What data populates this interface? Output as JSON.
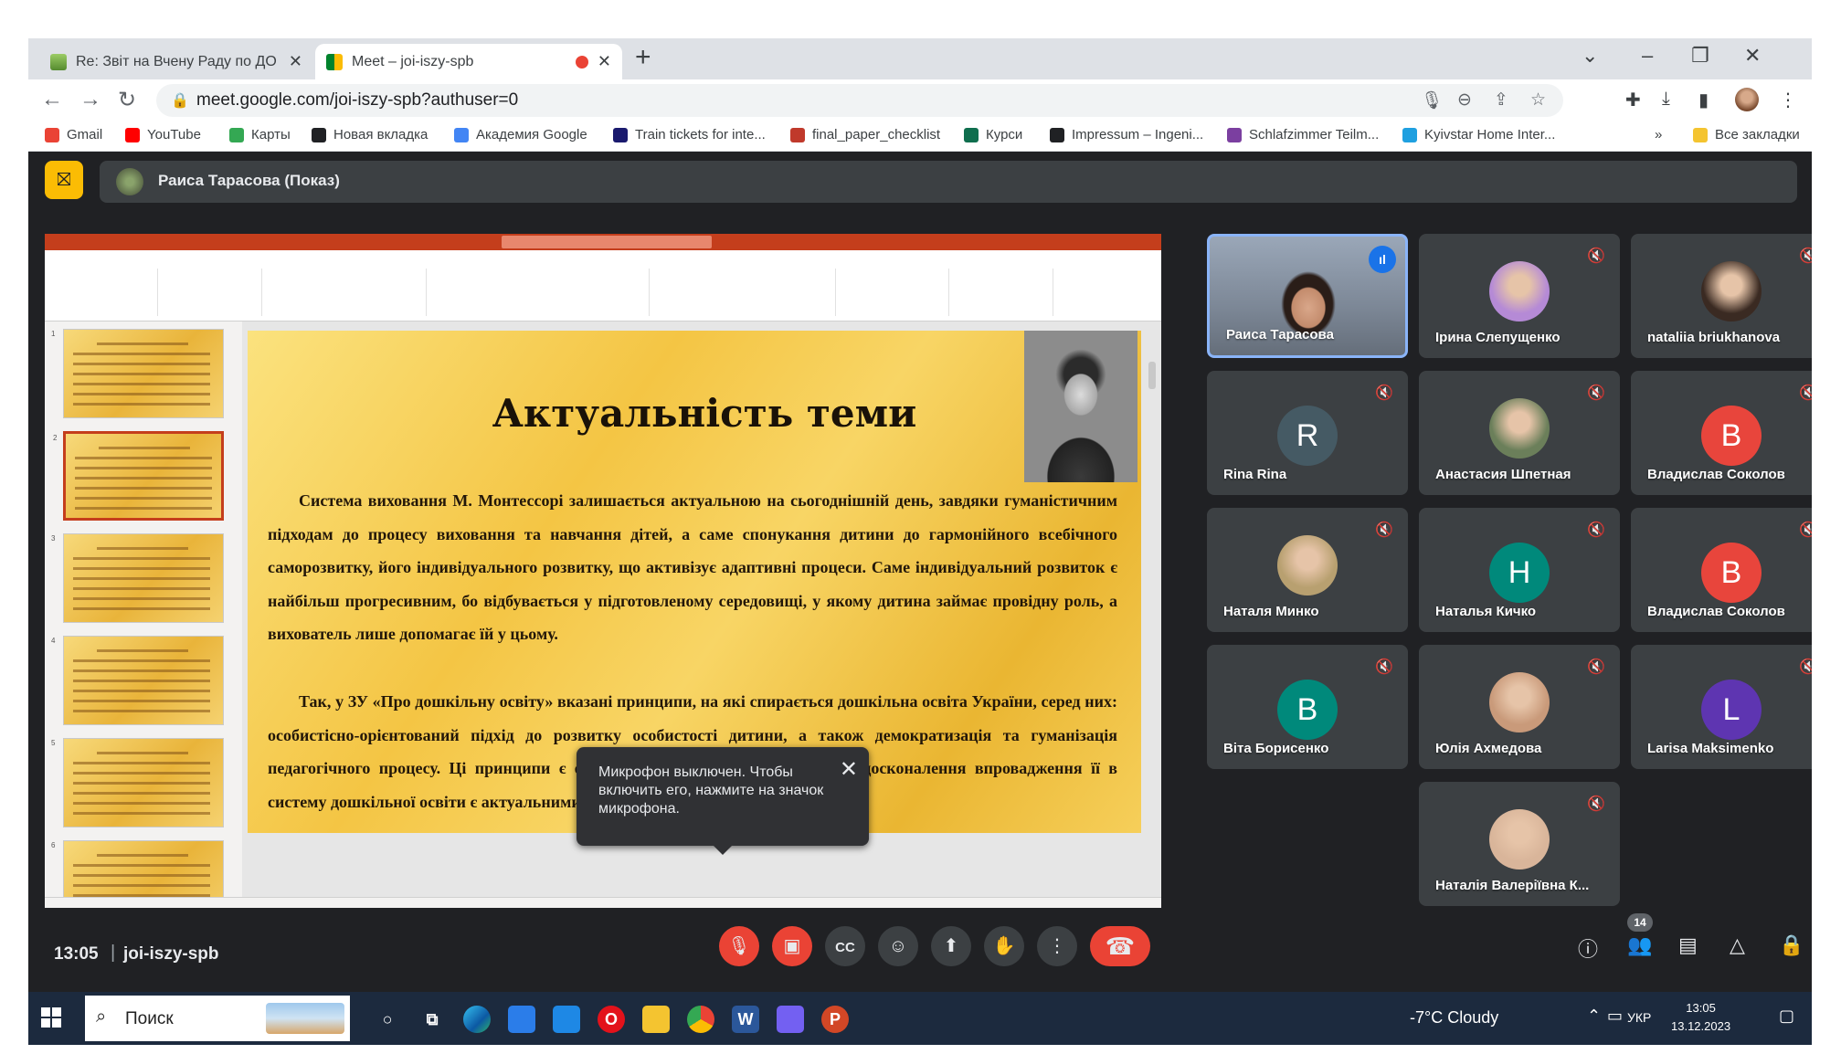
{
  "browser": {
    "tabs": [
      {
        "title": "Re: Звіт на Вчену Раду по ДО -",
        "favicon": "mail-icon"
      },
      {
        "title": "Meet – joi-iszy-spb",
        "favicon": "meet-icon",
        "recording": true
      }
    ],
    "url": "meet.google.com/joi-iszy-spb?authuser=0",
    "bookmarks": [
      {
        "label": "Gmail",
        "color": "#ea4335"
      },
      {
        "label": "YouTube",
        "color": "#ff0000"
      },
      {
        "label": "Карты",
        "color": "#34a853"
      },
      {
        "label": "Новая вкладка",
        "color": "#202124"
      },
      {
        "label": "Академия Google",
        "color": "#4285f4"
      },
      {
        "label": "Train tickets for inte...",
        "color": "#1a1a6e"
      },
      {
        "label": "final_paper_checklist",
        "color": "#c0392b"
      },
      {
        "label": "Курси",
        "color": "#0f6e4e"
      },
      {
        "label": "Impressum – Ingeni...",
        "color": "#202124"
      },
      {
        "label": "Schlafzimmer Teilm...",
        "color": "#7b3fa0"
      },
      {
        "label": "Kyivstar Home Inter...",
        "color": "#1fa0e0"
      }
    ],
    "bookmarks_overflow": "»",
    "all_bookmarks": "Все закладки"
  },
  "meet": {
    "presenter_label": "Раиса Тарасова (Показ)",
    "tooltip": "Микрофон выключен. Чтобы включить его, нажмите на значок микрофона.",
    "time": "13:05",
    "separator": "|",
    "meeting_code": "joi-iszy-spb",
    "people_count": "14",
    "participants": [
      {
        "name": "Раиса Тарасова",
        "type": "video"
      },
      {
        "name": "Ірина Слепущенко",
        "type": "photo",
        "color": "#b58ad6"
      },
      {
        "name": "nataliia briukhanova",
        "type": "photo",
        "color": "#3a2a22"
      },
      {
        "name": "Rina Rina",
        "type": "letter",
        "letter": "R",
        "color": "#455a64"
      },
      {
        "name": "Анастасия Шпетная",
        "type": "photo",
        "color": "#6b7f5a"
      },
      {
        "name": "Владислав Соколов",
        "type": "letter",
        "letter": "B",
        "color": "#e8453c"
      },
      {
        "name": "Наталя Минко",
        "type": "photo",
        "color": "#b8a070"
      },
      {
        "name": "Наталья Кичко",
        "type": "letter",
        "letter": "H",
        "color": "#00897b"
      },
      {
        "name": "Владислав Соколов",
        "type": "letter",
        "letter": "B",
        "color": "#e8453c"
      },
      {
        "name": "Віта Борисенко",
        "type": "letter",
        "letter": "B",
        "color": "#00897b"
      },
      {
        "name": "Юлія Ахмедова",
        "type": "photo",
        "color": "#c99a7a"
      },
      {
        "name": "Larisa Maksimenko",
        "type": "letter",
        "letter": "L",
        "color": "#5e35b1"
      },
      {
        "name": "Наталія Валеріївна К...",
        "type": "photo",
        "color": "#d9b59a"
      }
    ]
  },
  "slide": {
    "heading": "Актуальність теми",
    "paragraph1": "Система виховання М. Монтессорі залишається актуальною на сьогоднішній день, завдяки гуманістичним підходам до процесу виховання та навчання дітей, а саме спонукання дитини до гармонійного всебічного саморозвитку, його індивідуального розвитку, що активізує адаптивні процеси. Саме індивідуальний розвиток є найбільш прогресивним, бо відбувається у підготовленому середовищі, у якому дитина займає провідну роль, а вихователь лише допомагає їй у цьому.",
    "paragraph2": "Так, у ЗУ «Про дошкільну освіту» вказані принципи, на які спирається дошкільна освіта України, серед них: особистісно-орієнтований підхід до розвитку особистості дитини, а також демократизація та гуманізація педагогічного процесу. Ці принципи є основою системи Монтессорі, тому удосконалення впровадження її в систему дошкільної освіти є актуальними.",
    "thumbnails": [
      "1",
      "2",
      "3",
      "4",
      "5",
      "6"
    ]
  },
  "taskbar": {
    "search": "Поиск",
    "weather": "-7°C  Cloudy",
    "lang": "УКР",
    "time": "13:05",
    "date": "13.12.2023",
    "apps": [
      {
        "name": "cortana",
        "color": "#1c2a3e"
      },
      {
        "name": "task-view",
        "color": "#1c2a3e"
      },
      {
        "name": "edge",
        "color": "#0f8fd6"
      },
      {
        "name": "store",
        "color": "#2b7de9"
      },
      {
        "name": "mail",
        "color": "#1e88e5"
      },
      {
        "name": "opera",
        "color": "#e3121b"
      },
      {
        "name": "explorer",
        "color": "#f4c430"
      },
      {
        "name": "chrome",
        "color": "#4285f4"
      },
      {
        "name": "word",
        "color": "#2b579a"
      },
      {
        "name": "viber",
        "color": "#7360f2"
      },
      {
        "name": "powerpoint",
        "color": "#d24726"
      }
    ]
  }
}
